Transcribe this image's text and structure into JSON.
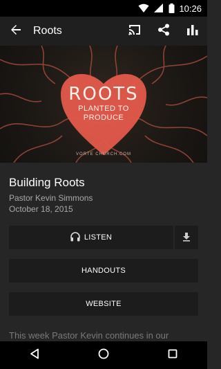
{
  "status_bar": {
    "time": "10:26",
    "icons": [
      "wifi-icon",
      "signal-icon",
      "battery-icon"
    ]
  },
  "app_bar": {
    "title": "Roots",
    "back_icon": "arrow-back-icon",
    "actions": [
      "cast-icon",
      "share-icon",
      "bar-chart-icon"
    ]
  },
  "hero": {
    "title": "ROOTS",
    "subtitle_line1": "PLANTED TO",
    "subtitle_line2": "PRODUCE",
    "site": "VORTE  CHURCH.COM",
    "heart_color": "#e35a4b"
  },
  "sermon": {
    "title": "Building Roots",
    "speaker": "Pastor Kevin Simmons",
    "date": "October 18, 2015"
  },
  "buttons": {
    "listen": "LISTEN",
    "handouts": "HANDOUTS",
    "website": "WEBSITE"
  },
  "description": "This week Pastor Kevin continues in our",
  "nav_bar": {
    "icons": [
      "back-triangle-icon",
      "home-circle-icon",
      "recents-square-icon"
    ]
  }
}
